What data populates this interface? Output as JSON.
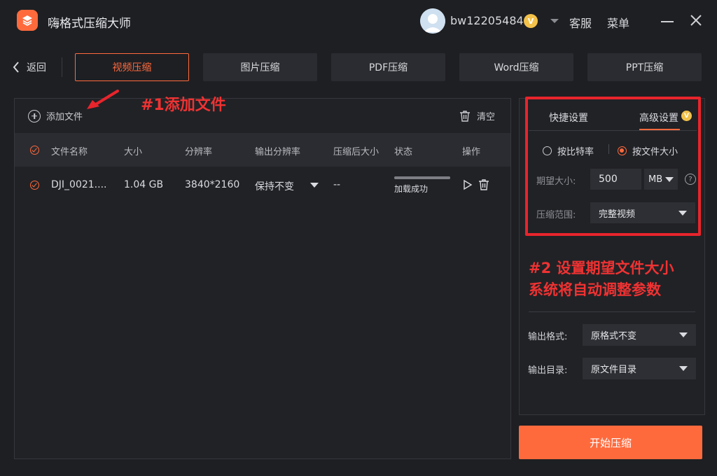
{
  "app": {
    "title": "嗨格式压缩大师",
    "username": "bw12205484",
    "vip_badge": "V",
    "service_label": "客服",
    "menu_label": "菜单"
  },
  "nav": {
    "back_label": "返回",
    "tabs": [
      {
        "label": "视频压缩",
        "active": true
      },
      {
        "label": "图片压缩",
        "active": false
      },
      {
        "label": "PDF压缩",
        "active": false
      },
      {
        "label": "Word压缩",
        "active": false
      },
      {
        "label": "PPT压缩",
        "active": false
      }
    ]
  },
  "toolbar": {
    "add_label": "添加文件",
    "clear_label": "清空"
  },
  "table": {
    "headers": [
      "文件名称",
      "大小",
      "分辨率",
      "输出分辨率",
      "压缩后大小",
      "状态",
      "操作"
    ],
    "rows": [
      {
        "name": "DJI_0021....",
        "size": "1.04 GB",
        "resolution": "3840*2160",
        "output_resolution": "保持不变",
        "compressed_size": "--",
        "status": "加载成功",
        "progress": 1.0
      }
    ]
  },
  "annotations": {
    "step1": "#1添加文件",
    "step2_line1": "#2 设置期望文件大小",
    "step2_line2": "系统将自动调整参数"
  },
  "settings": {
    "tab_quick": "快捷设置",
    "tab_advanced": "高级设置",
    "mode_bitrate": "按比特率",
    "mode_filesize": "按文件大小",
    "expected_size_label": "期望大小:",
    "expected_size_value": "500",
    "unit": "MB",
    "help": "?",
    "range_label": "压缩范围:",
    "range_value": "完整视频",
    "output_format_label": "输出格式:",
    "output_format_value": "原格式不变",
    "output_dir_label": "输出目录:",
    "output_dir_value": "原文件目录"
  },
  "start_button": "开始压缩",
  "colors": {
    "accent": "#ff6a3d",
    "annotation": "#f03232",
    "background": "#1e1f23",
    "panel": "#212226"
  }
}
